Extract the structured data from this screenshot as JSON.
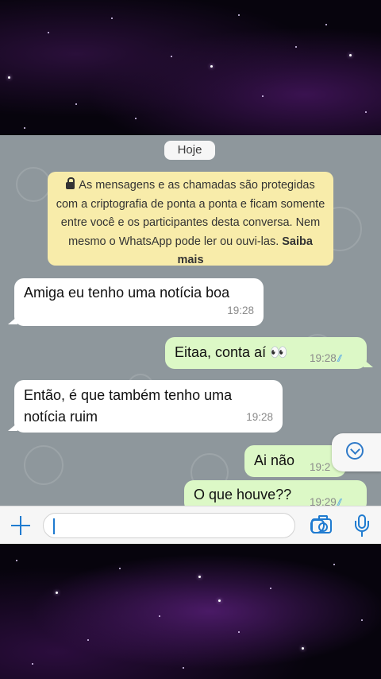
{
  "chat": {
    "date_label": "Hoje",
    "encryption_notice": {
      "text": "As mensagens e as chamadas são protegidas com a criptografia de ponta a ponta e ficam somente entre você e os participantes desta conversa. Nem mesmo o WhatsApp pode ler ou ouvi-las.",
      "link_label": "Saiba mais"
    },
    "messages": [
      {
        "direction": "incoming",
        "text": "Amiga eu tenho uma notícia boa",
        "time": "19:28"
      },
      {
        "direction": "outgoing",
        "text": "Eitaa, conta aí 👀",
        "time": "19:28",
        "status": "read"
      },
      {
        "direction": "incoming",
        "text": "Então, é que também tenho uma notícia ruim",
        "time": "19:28"
      },
      {
        "direction": "outgoing",
        "text": "Ai não",
        "time": "19:2",
        "status": "read"
      },
      {
        "direction": "outgoing",
        "text": "O que houve??",
        "time": "19:29",
        "status": "read"
      }
    ]
  },
  "composer": {
    "input_value": "",
    "icons": [
      "plus-icon",
      "sticker-icon",
      "camera-icon",
      "microphone-icon"
    ]
  },
  "scroll_button": {
    "icon": "chevron-down-circle-icon"
  },
  "colors": {
    "chat_background": "#8e979c",
    "incoming_bubble": "#ffffff",
    "outgoing_bubble": "#dcf8c6",
    "notice_background": "#f8ecaa",
    "accent": "#1f7bd0",
    "read_ticks": "#5aa9e6"
  }
}
